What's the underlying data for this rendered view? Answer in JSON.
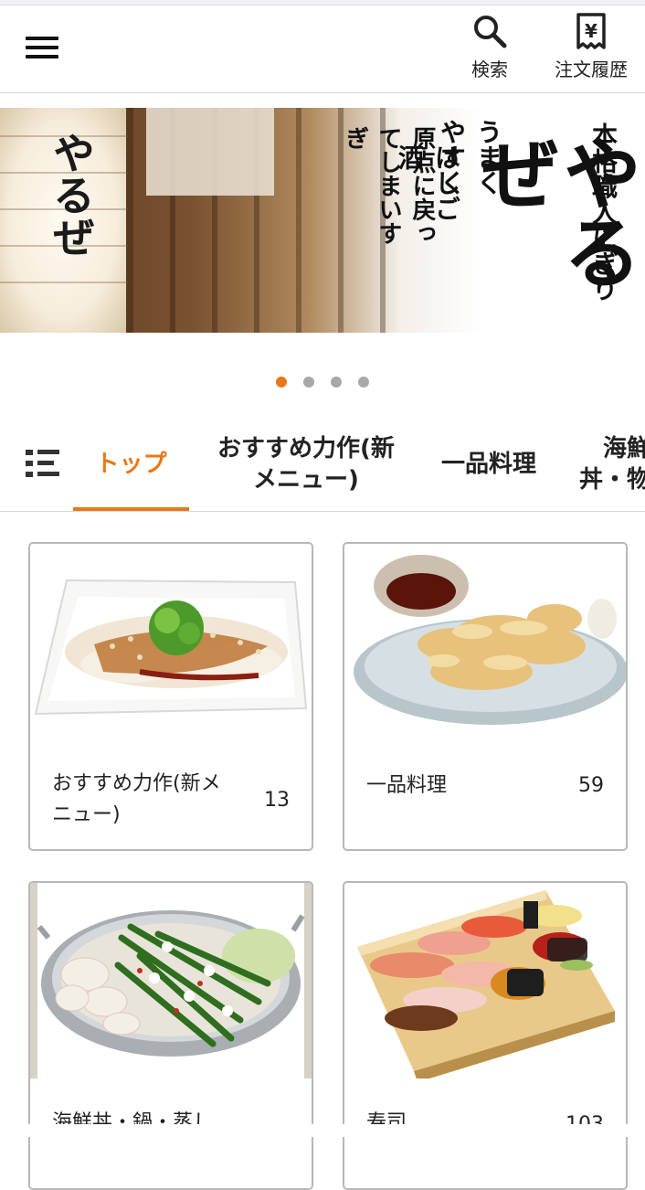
{
  "header": {
    "search_label": "検索",
    "history_label": "注文履歴",
    "history_icon_glyph": "¥"
  },
  "banner": {
    "lantern_text": "やるぜ",
    "big_calligraphy": "やるぜ",
    "side_calligraphy_1": "本格職人にぎり",
    "side_calligraphy_2": "うまくやすく",
    "side_calligraphy_3": "はしご酒",
    "side_calligraphy_4": "原点に戻ってしまいすぎ",
    "slides_total": 4,
    "active_slide": 1
  },
  "categories": {
    "tabs": [
      {
        "label": "トップ",
        "active": true
      },
      {
        "label": "おすすめ力作(新メニュー)",
        "active": false
      },
      {
        "label": "一品料理",
        "active": false
      },
      {
        "label": "海鮮丼・物",
        "active": false
      }
    ]
  },
  "cards": [
    {
      "title": "おすすめ力作(新メニュー)",
      "count": "13",
      "photo": "gyoza-plate"
    },
    {
      "title": "一品料理",
      "count": "59",
      "photo": "tempura-plate"
    },
    {
      "title": "海鮮丼・鍋・蒸し",
      "count": "",
      "photo": "motsunabe-pot"
    },
    {
      "title": "寿司",
      "count": "103",
      "photo": "sushi-board"
    }
  ],
  "colors": {
    "accent": "#e8781a",
    "divider": "#d6d6d6",
    "card_border": "#b8b8b8"
  }
}
